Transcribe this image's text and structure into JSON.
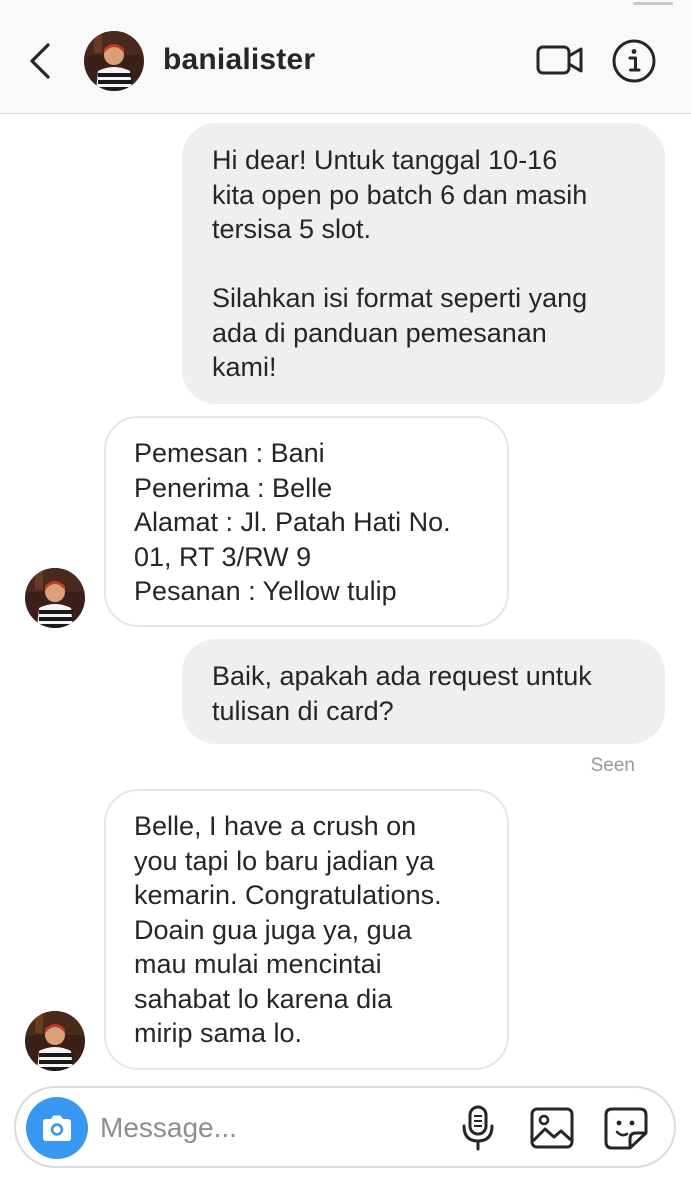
{
  "header": {
    "username": "banialister",
    "icons": {
      "back": "chevron-left-icon",
      "video": "video-camera-icon",
      "info": "info-icon"
    }
  },
  "messages": [
    {
      "direction": "outgoing",
      "text": "Hi dear! Untuk tanggal 10-16\nkita open po batch 6 dan masih\ntersisa 5 slot.\n\nSilahkan isi format seperti yang\nada di panduan pemesanan\nkami!"
    },
    {
      "direction": "incoming",
      "text": "Pemesan : Bani\nPenerima : Belle\nAlamat : Jl. Patah Hati No.\n01, RT 3/RW 9\nPesanan : Yellow tulip"
    },
    {
      "direction": "outgoing",
      "text": "Baik, apakah ada request untuk\ntulisan di card?"
    },
    {
      "direction": "incoming",
      "text": "Belle, I have a crush on\nyou tapi lo baru jadian ya\nkemarin. Congratulations.\nDoain gua juga ya, gua\nmau mulai mencintai\nsahabat lo karena dia\nmirip sama lo."
    }
  ],
  "seen_label": "Seen",
  "composer": {
    "placeholder": "Message...",
    "icons": {
      "camera": "camera-icon",
      "mic": "microphone-icon",
      "gallery": "image-icon",
      "sticker": "sticker-icon"
    }
  },
  "colors": {
    "header_bg": "#f9f9f9",
    "outgoing_bubble": "#efefef",
    "incoming_border": "#e6e6e6",
    "camera_button": "#3897f0",
    "seen_text": "#999999"
  }
}
